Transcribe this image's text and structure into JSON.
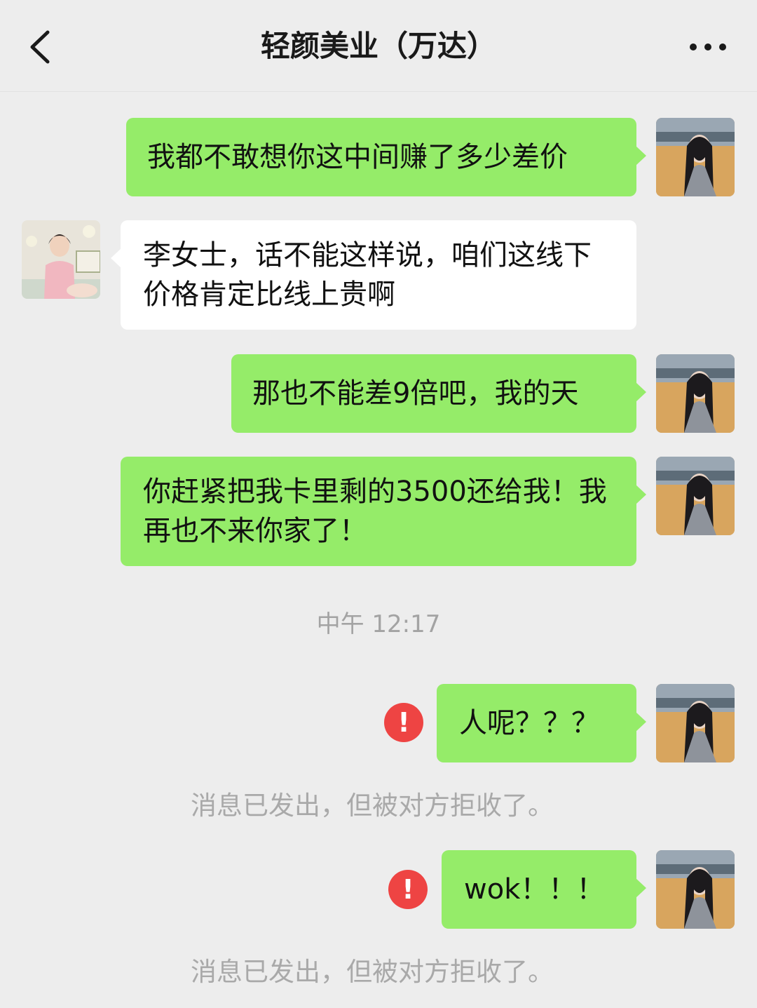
{
  "header": {
    "title": "轻颜美业（万达）",
    "back_icon": "chevron-left-icon",
    "more_icon": "more-dots-icon"
  },
  "messages": [
    {
      "sender": "me",
      "text": "我都不敢想你这中间赚了多少差价"
    },
    {
      "sender": "them",
      "text": "李女士，话不能这样说，咱们这线下价格肯定比线上贵啊"
    },
    {
      "sender": "me",
      "text": "那也不能差9倍吧，我的天"
    },
    {
      "sender": "me",
      "text": "你赶紧把我卡里剩的3500还给我！我再也不来你家了！"
    },
    {
      "sender": "me",
      "text": "人呢？？？",
      "failed": true
    },
    {
      "sender": "me",
      "text": "wok！！！",
      "failed": true
    }
  ],
  "timestamp": "中午 12:17",
  "system": {
    "rejected_notice": "消息已发出，但被对方拒收了。",
    "error_mark": "!"
  },
  "colors": {
    "background": "#ededed",
    "my_bubble": "#95ec69",
    "their_bubble": "#ffffff",
    "error": "#ee4443",
    "muted_text": "#a9a9a9"
  }
}
